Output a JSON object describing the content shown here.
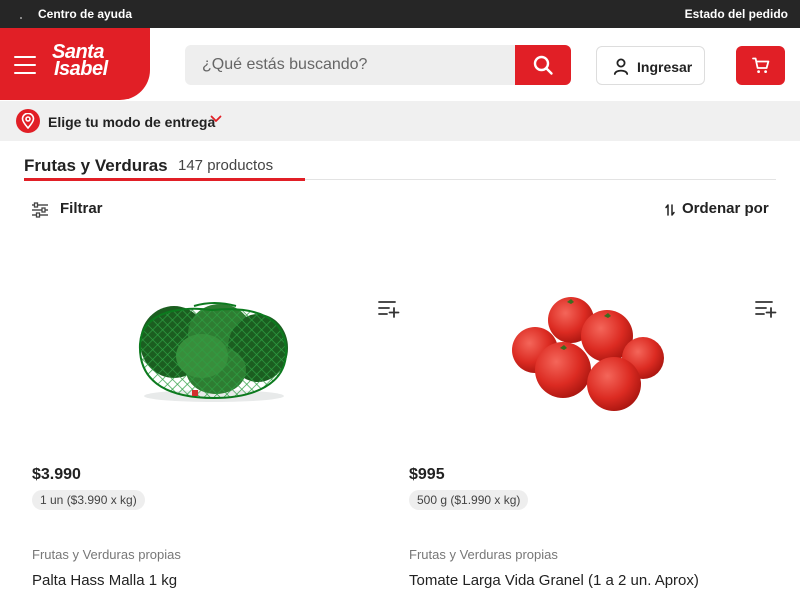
{
  "topbar": {
    "help": "Centro de ayuda",
    "order_status": "Estado del pedido"
  },
  "brand": {
    "line1": "Santa",
    "line2": "Isabel",
    "color": "#e11f26"
  },
  "search": {
    "placeholder": "¿Qué estás buscando?",
    "value": ""
  },
  "header": {
    "login_label": "Ingresar"
  },
  "delivery": {
    "label": "Elige tu modo de entrega"
  },
  "category": {
    "title": "Frutas y Verduras",
    "count": "147 productos"
  },
  "toolbar": {
    "filter_label": "Filtrar",
    "sort_label": "Ordenar por"
  },
  "products": [
    {
      "price": "$3.990",
      "unit": "1 un ($3.990 x kg)",
      "brand": "Frutas y Verduras propias",
      "name": "Palta Hass Malla 1 kg",
      "image_icon": "avocado-mesh-bag"
    },
    {
      "price": "$995",
      "unit": "500 g ($1.990 x kg)",
      "brand": "Frutas y Verduras propias",
      "name": "Tomate Larga Vida Granel (1 a 2 un. Aprox)",
      "image_icon": "tomatoes"
    }
  ],
  "icons": {
    "menu": "hamburger-icon",
    "search": "search-icon",
    "user": "user-icon",
    "cart": "cart-icon",
    "location": "location-pin-icon",
    "chevron": "chevron-down-icon",
    "filter": "sliders-icon",
    "sort": "sort-arrows-icon",
    "add_to_list": "add-to-list-icon"
  }
}
